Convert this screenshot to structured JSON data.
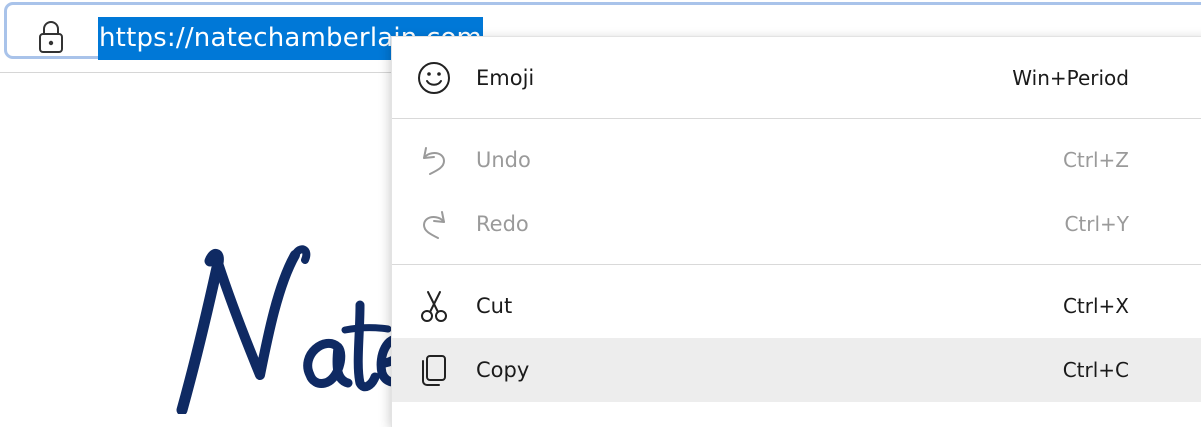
{
  "address_bar": {
    "url": "https://natechamberlain.com",
    "lock_icon": "lock-icon"
  },
  "context_menu": {
    "items": [
      {
        "label": "Emoji",
        "shortcut": "Win+Period",
        "icon": "emoji-icon",
        "enabled": true
      },
      {
        "label": "Undo",
        "shortcut": "Ctrl+Z",
        "icon": "undo-icon",
        "enabled": false
      },
      {
        "label": "Redo",
        "shortcut": "Ctrl+Y",
        "icon": "redo-icon",
        "enabled": false
      },
      {
        "label": "Cut",
        "shortcut": "Ctrl+X",
        "icon": "cut-icon",
        "enabled": true
      },
      {
        "label": "Copy",
        "shortcut": "Ctrl+C",
        "icon": "copy-icon",
        "enabled": true,
        "highlighted": true
      }
    ]
  },
  "colors": {
    "selection": "#0078d7",
    "focus_border": "#a9c3ea",
    "logo_navy": "#0f2a63",
    "disabled_text": "#9a9a9a",
    "hover_bg": "#ededed"
  }
}
